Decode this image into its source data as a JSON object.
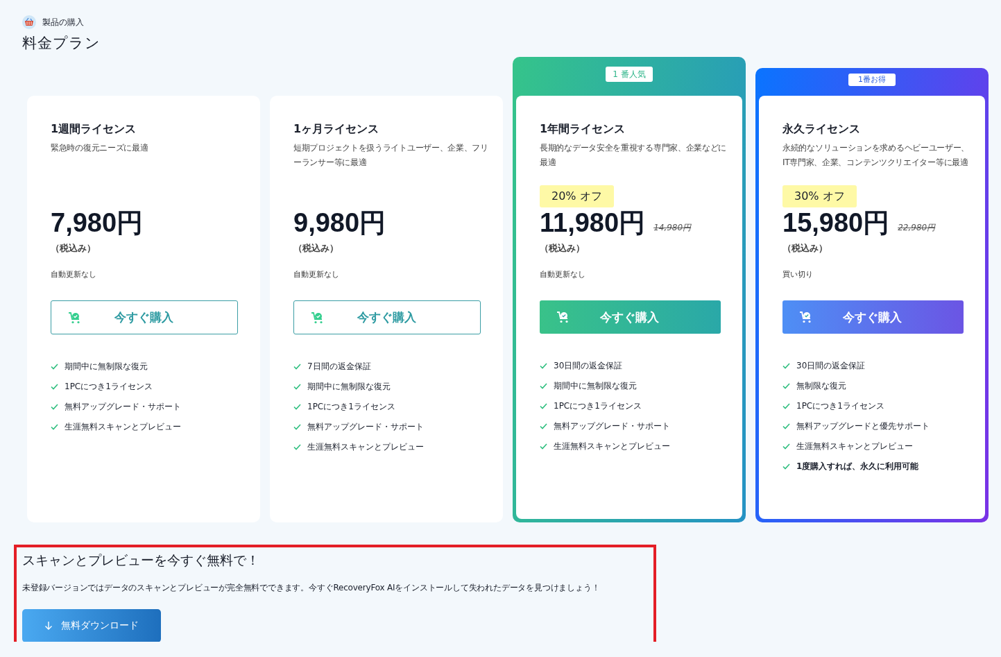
{
  "breadcrumb": "製品の購入",
  "title": "料金プラン",
  "plans": [
    {
      "kind": "plain",
      "name": "1週間ライセンス",
      "description": "緊急時の復元ニーズに最適",
      "price": "7,980円",
      "tax_note": "（税込み）",
      "renewal": "自動更新なし",
      "button": "今すぐ購入",
      "features": [
        {
          "text": "期間中に無制限な復元",
          "bold": false
        },
        {
          "text": "1PCにつき1ライセンス",
          "bold": false
        },
        {
          "text": "無料アップグレード・サポート",
          "bold": false
        },
        {
          "text": "生涯無料スキャンとプレビュー",
          "bold": false
        }
      ]
    },
    {
      "kind": "plain",
      "name": "1ヶ月ライセンス",
      "description": "短期プロジェクトを扱うライトユーザー、企業、フリーランサー等に最適",
      "price": "9,980円",
      "tax_note": "（税込み）",
      "renewal": "自動更新なし",
      "button": "今すぐ購入",
      "features": [
        {
          "text": "7日間の返金保証",
          "bold": false
        },
        {
          "text": "期間中に無制限な復元",
          "bold": false
        },
        {
          "text": "1PCにつき1ライセンス",
          "bold": false
        },
        {
          "text": "無料アップグレード・サポート",
          "bold": false
        },
        {
          "text": "生涯無料スキャンとプレビュー",
          "bold": false
        }
      ]
    },
    {
      "kind": "green",
      "badge": "1 番人気",
      "name": "1年間ライセンス",
      "description": "長期的なデータ安全を重視する専門家、企業などに最適",
      "discount": "20% オフ",
      "price": "11,980円",
      "original_price": "14,980円",
      "tax_note": "（税込み）",
      "renewal": "自動更新なし",
      "button": "今すぐ購入",
      "features": [
        {
          "text": "30日間の返金保証",
          "bold": false
        },
        {
          "text": "期間中に無制限な復元",
          "bold": false
        },
        {
          "text": "1PCにつき1ライセンス",
          "bold": false
        },
        {
          "text": "無料アップグレード・サポート",
          "bold": false
        },
        {
          "text": "生涯無料スキャンとプレビュー",
          "bold": false
        }
      ]
    },
    {
      "kind": "blue",
      "badge": "1番お得",
      "name": "永久ライセンス",
      "description": "永続的なソリューションを求めるヘビーユーザー、IT専門家、企業、コンテンツクリエイター等に最適",
      "discount": "30% オフ",
      "price": "15,980円",
      "original_price": "22,980円",
      "tax_note": "（税込み）",
      "renewal": "買い切り",
      "button": "今すぐ購入",
      "features": [
        {
          "text": "30日間の返金保証",
          "bold": false
        },
        {
          "text": "無制限な復元",
          "bold": false
        },
        {
          "text": "1PCにつき1ライセンス",
          "bold": false
        },
        {
          "text": "無料アップグレードと優先サポート",
          "bold": false
        },
        {
          "text": "生涯無料スキャンとプレビュー",
          "bold": false
        },
        {
          "text": "1度購入すれば、永久に利用可能",
          "bold": true
        }
      ]
    }
  ],
  "promo": {
    "heading": "スキャンとプレビューを今すぐ無料で！",
    "text": "未登録バージョンではデータのスキャンとプレビューが完全無料でできます。今すぐRecoveryFox AIをインストールして失われたデータを見つけましょう！",
    "button": "無料ダウンロード"
  }
}
